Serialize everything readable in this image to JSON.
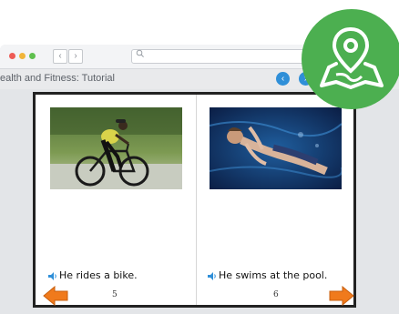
{
  "window": {
    "title": "ealth and Fitness: Tutorial"
  },
  "colors": {
    "accent": "#2f8fd8",
    "arrow": "#f07a1c",
    "badge": "#4caf50"
  },
  "icons": {
    "back": "chevron-left-icon",
    "forward": "chevron-right-icon",
    "search": "search-icon",
    "badge": "map-pin-icon"
  },
  "book": {
    "left_page": {
      "caption": "He rides a bike.",
      "page_number": "5"
    },
    "right_page": {
      "caption": "He swims at the pool.",
      "page_number": "6"
    }
  }
}
